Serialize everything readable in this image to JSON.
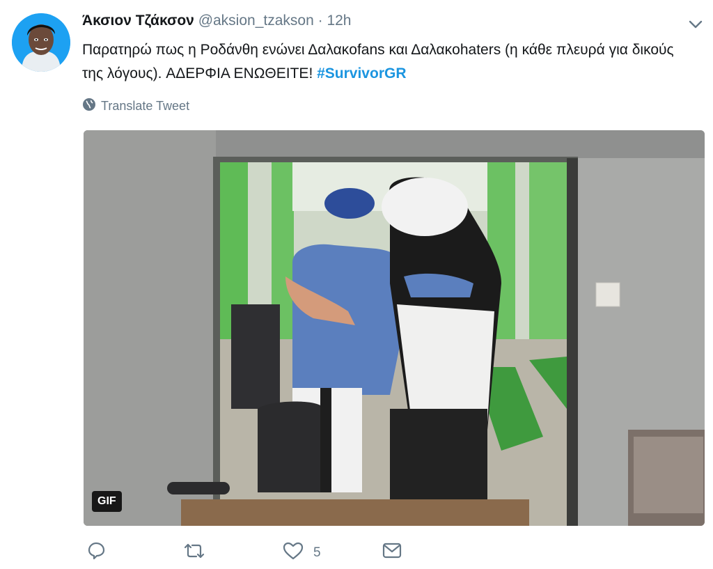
{
  "tweet": {
    "display_name": "Άκσιον Τζάκσον",
    "handle": "@aksion_tzakson",
    "separator": "·",
    "time": "12h",
    "text_before": "Παρατηρώ πως η Ροδάνθη ενώνει Δαλακofans και Δαλακohaters (η κάθε πλευρά για δικούς της λόγους). ΑΔΕΡΦΙΑ ΕΝΩΘΕΙΤΕ! ",
    "hashtag": "#SurvivorGR",
    "translate_label": "Translate Tweet"
  },
  "media": {
    "badge": "GIF"
  },
  "actions": {
    "reply_count": "",
    "retweet_count": "",
    "like_count": "5"
  },
  "colors": {
    "accent": "#1da1f2",
    "hashtag": "#1b95e0",
    "muted": "#657786"
  },
  "icons": [
    "caret-down-icon",
    "globe-icon",
    "reply-icon",
    "retweet-icon",
    "like-icon",
    "message-icon"
  ]
}
